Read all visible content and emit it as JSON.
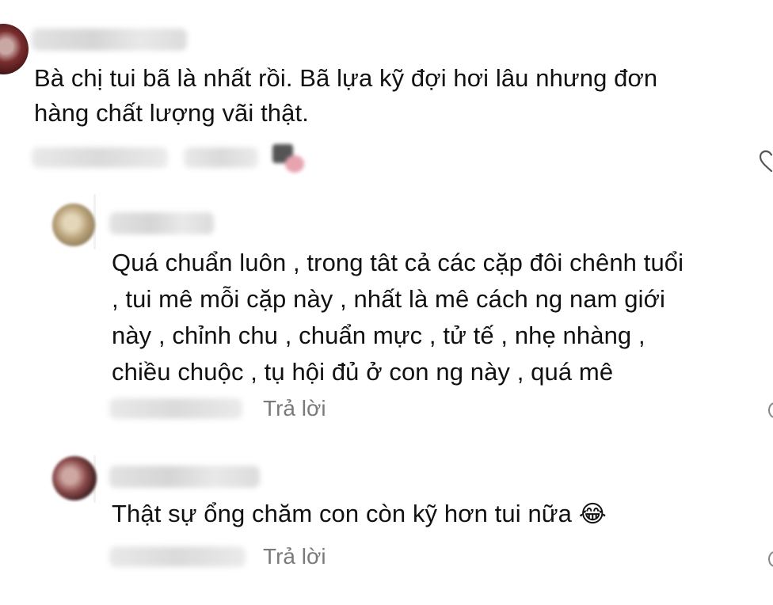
{
  "comments": [
    {
      "text": "Bà chị tui bã là nhất rồi. Bã lựa kỹ đợi hơi lâu nhưng đơn hàng chất lượng vãi thật.",
      "line1": "Bà chị tui bã là nhất rồi. Bã lựa kỹ đợi hơi lâu nhưng đơn",
      "line2": "hàng chất lượng vãi thật."
    }
  ],
  "replies": [
    {
      "lines": [
        "Quá chuẩn luôn , trong tât cả các cặp đôi chênh tuổi",
        ", tui mê mỗi cặp này , nhất là mê cách ng nam giới",
        "này , chỉnh chu , chuẩn mực , tử tế , nhẹ nhàng ,",
        "chiều chuộc , tụ hội đủ ở con ng này , quá mê"
      ],
      "reply_label": "Trả lời"
    },
    {
      "text": "Thật sự ổng chăm con còn kỹ hơn tui nữa",
      "emoji": "😂",
      "reply_label": "Trả lời"
    }
  ],
  "icons": {
    "like": "heart-icon",
    "react": "tears-of-joy-emoji"
  }
}
